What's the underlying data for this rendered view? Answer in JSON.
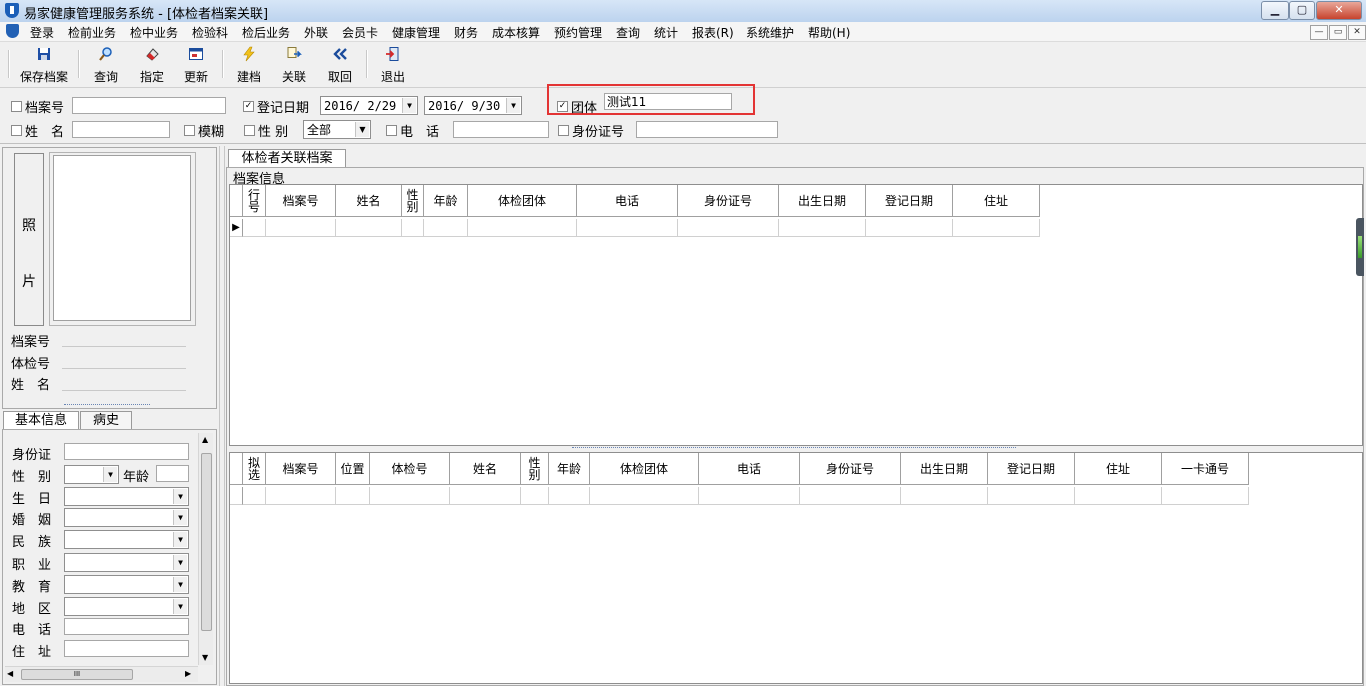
{
  "window": {
    "title": "易家健康管理服务系统 - [体检者档案关联]",
    "controls": {
      "minimize": "▁",
      "maximize": "▢",
      "close": "✕"
    }
  },
  "menu": {
    "items": [
      "登录",
      "检前业务",
      "检中业务",
      "检验科",
      "检后业务",
      "外联",
      "会员卡",
      "健康管理",
      "财务",
      "成本核算",
      "预约管理",
      "查询",
      "统计",
      "报表(R)",
      "系统维护",
      "帮助(H)"
    ],
    "mdi_controls": [
      "—",
      "▭",
      "✕"
    ]
  },
  "toolbar": {
    "buttons": [
      {
        "label": "保存档案",
        "icon": "save-icon"
      },
      {
        "label": "查询",
        "icon": "search-icon"
      },
      {
        "label": "指定",
        "icon": "eraser-icon"
      },
      {
        "label": "更新",
        "icon": "window-icon"
      },
      {
        "label": "建档",
        "icon": "lightning-icon"
      },
      {
        "label": "关联",
        "icon": "link-icon"
      },
      {
        "label": "取回",
        "icon": "rewind-icon"
      },
      {
        "label": "退出",
        "icon": "exit-icon"
      }
    ]
  },
  "filters": {
    "archive_no": {
      "label": "档案号",
      "checked": false,
      "value": ""
    },
    "reg_date": {
      "label": "登记日期",
      "checked": true,
      "from": "2016/ 2/29",
      "to": "2016/ 9/30"
    },
    "group": {
      "label": "团体",
      "checked": true,
      "value": "测试11"
    },
    "name": {
      "label": "姓　名",
      "checked": false,
      "value": ""
    },
    "fuzzy": {
      "label": "模糊",
      "checked": false
    },
    "gender": {
      "label": "性 别",
      "checked": false,
      "value": "全部"
    },
    "phone": {
      "label": "电　话",
      "checked": false,
      "value": ""
    },
    "id_no": {
      "label": "身份证号",
      "checked": false,
      "value": ""
    }
  },
  "left_panel": {
    "photo_button": "照\n\n片",
    "info_labels": [
      "档案号",
      "体检号",
      "姓　名"
    ],
    "tabs": [
      "基本信息",
      "病史"
    ],
    "form_fields": [
      {
        "label": "身份证",
        "type": "text"
      },
      {
        "label": "性　别",
        "type": "combo-small",
        "extra_label": "年龄"
      },
      {
        "label": "生　日",
        "type": "combo"
      },
      {
        "label": "婚　姻",
        "type": "combo"
      },
      {
        "label": "民　族",
        "type": "combo"
      },
      {
        "label": "职　业",
        "type": "combo"
      },
      {
        "label": "教　育",
        "type": "combo"
      },
      {
        "label": "地　区",
        "type": "combo"
      },
      {
        "label": "电　话",
        "type": "text"
      },
      {
        "label": "住　址",
        "type": "text"
      }
    ],
    "scroll_grip": "III"
  },
  "main": {
    "tab": "体检者关联档案",
    "section_label": "档案信息",
    "grid_top": {
      "columns": [
        "行\n号",
        "档案号",
        "姓名",
        "性\n别",
        "年龄",
        "体检团体",
        "电话",
        "身份证号",
        "出生日期",
        "登记日期",
        "住址"
      ],
      "row_indicator": "▶"
    },
    "grid_bottom": {
      "columns": [
        "拟\n选",
        "档案号",
        "位置",
        "体检号",
        "姓名",
        "性\n别",
        "年龄",
        "体检团体",
        "电话",
        "身份证号",
        "出生日期",
        "登记日期",
        "住址",
        "一卡通号"
      ]
    }
  }
}
